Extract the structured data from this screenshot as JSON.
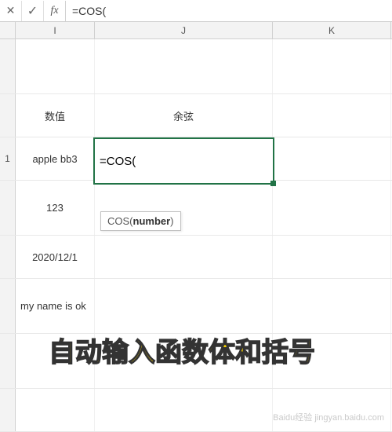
{
  "formula_bar": {
    "input": "=COS("
  },
  "columns": {
    "I": "I",
    "J": "J",
    "K": "K"
  },
  "cells": {
    "header_A": "数值",
    "header_B": "余弦",
    "row_num_1": "1",
    "I3": "apple bb3",
    "J3_editing": "=COS(",
    "I4": "123",
    "I5": "2020/12/1",
    "I6": "my name is ok"
  },
  "tooltip": {
    "fn": "COS(",
    "arg": "number",
    "close": ")"
  },
  "annotation": "自动输入函数体和括号",
  "watermark": "Baidu经验\njingyan.baidu.com"
}
